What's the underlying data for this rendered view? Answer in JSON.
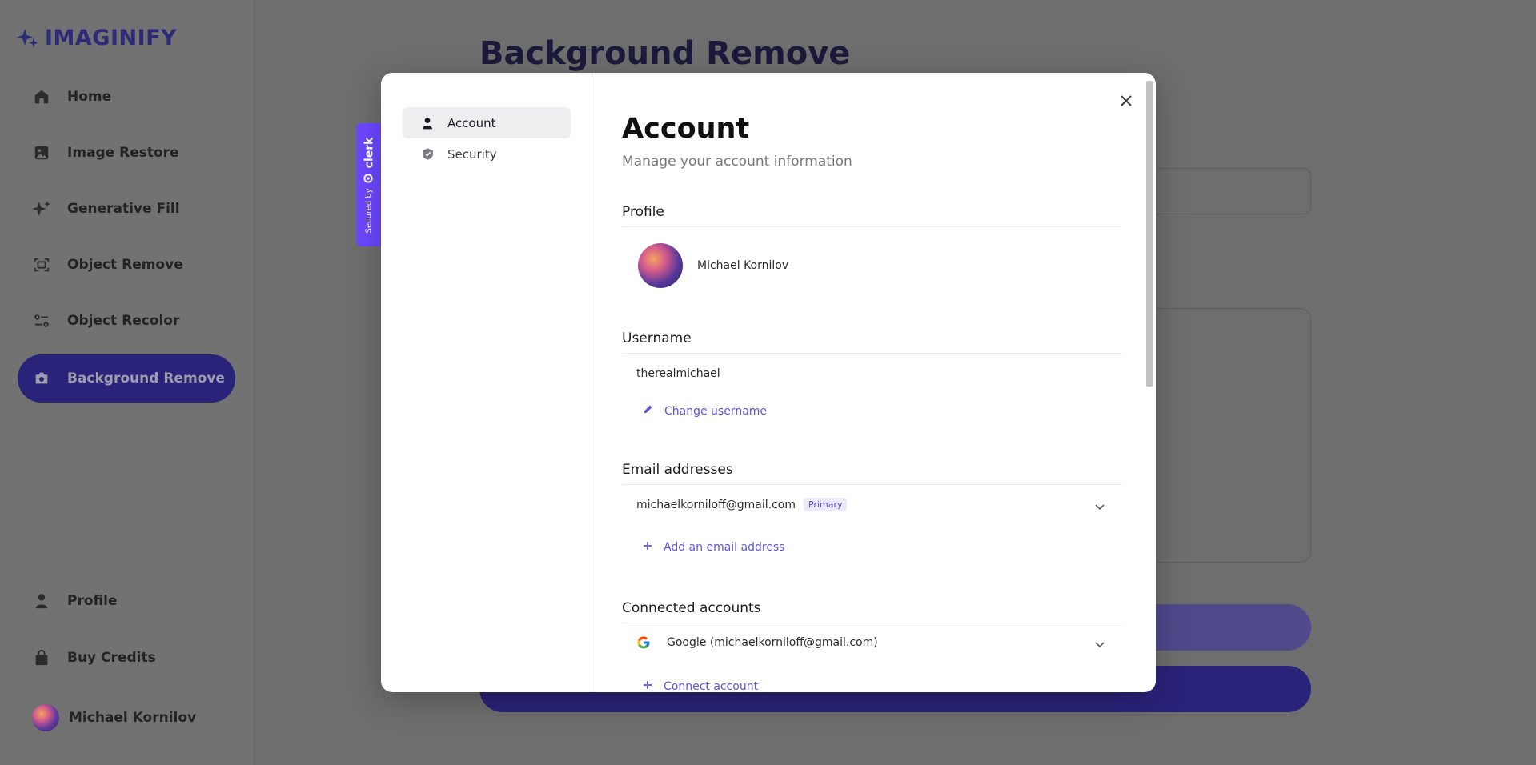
{
  "app": {
    "logo": "IMAGINIFY",
    "nav": [
      {
        "label": "Home",
        "icon": "home-icon"
      },
      {
        "label": "Image Restore",
        "icon": "image-icon"
      },
      {
        "label": "Generative Fill",
        "icon": "stars-icon"
      },
      {
        "label": "Object Remove",
        "icon": "scan-icon"
      },
      {
        "label": "Object Recolor",
        "icon": "filter-icon"
      },
      {
        "label": "Background Remove",
        "icon": "camera-icon",
        "active": true
      }
    ],
    "bottom_nav": [
      {
        "label": "Profile",
        "icon": "user-icon"
      },
      {
        "label": "Buy Credits",
        "icon": "bag-icon"
      }
    ],
    "user_name": "Michael Kornilov",
    "page_title": "Background Remove"
  },
  "clerk_badge": {
    "secured_by": "Secured by",
    "brand": "clerk"
  },
  "modal": {
    "nav": [
      {
        "label": "Account",
        "active": true
      },
      {
        "label": "Security",
        "active": false
      }
    ],
    "title": "Account",
    "subtitle": "Manage your account information",
    "profile": {
      "section": "Profile",
      "name": "Michael Kornilov"
    },
    "username": {
      "section": "Username",
      "value": "therealmichael",
      "action": "Change username"
    },
    "email": {
      "section": "Email addresses",
      "value": "michaelkorniloff@gmail.com",
      "badge": "Primary",
      "action": "Add an email address"
    },
    "connected": {
      "section": "Connected accounts",
      "value": "Google (michaelkorniloff@gmail.com)",
      "action": "Connect account"
    }
  },
  "colors": {
    "accent": "#5d55d6",
    "brand_dark": "#2a237a",
    "clerk": "#6c47ff"
  }
}
